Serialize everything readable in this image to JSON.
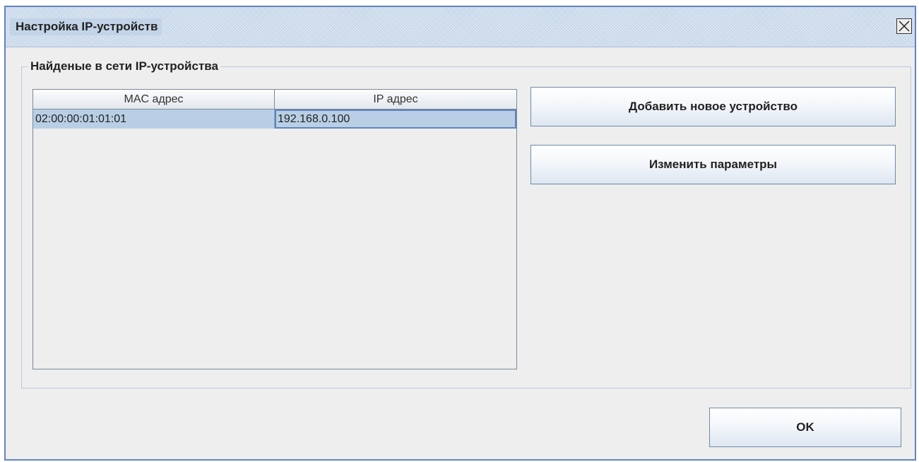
{
  "window": {
    "title": "Настройка IP-устройств",
    "close_icon": "close-icon"
  },
  "group": {
    "title": "Найденые в сети IP-устройства"
  },
  "table": {
    "columns": [
      "MAC адрес",
      "IP адрес"
    ],
    "rows": [
      {
        "mac": "02:00:00:01:01:01",
        "ip": "192.168.0.100"
      }
    ]
  },
  "buttons": {
    "add_label": "Добавить новое устройство",
    "edit_label": "Изменить параметры",
    "ok_label": "OK"
  },
  "colors": {
    "window_border": "#6382bf",
    "selection": "#b8cfe5",
    "background": "#eeeeee"
  }
}
